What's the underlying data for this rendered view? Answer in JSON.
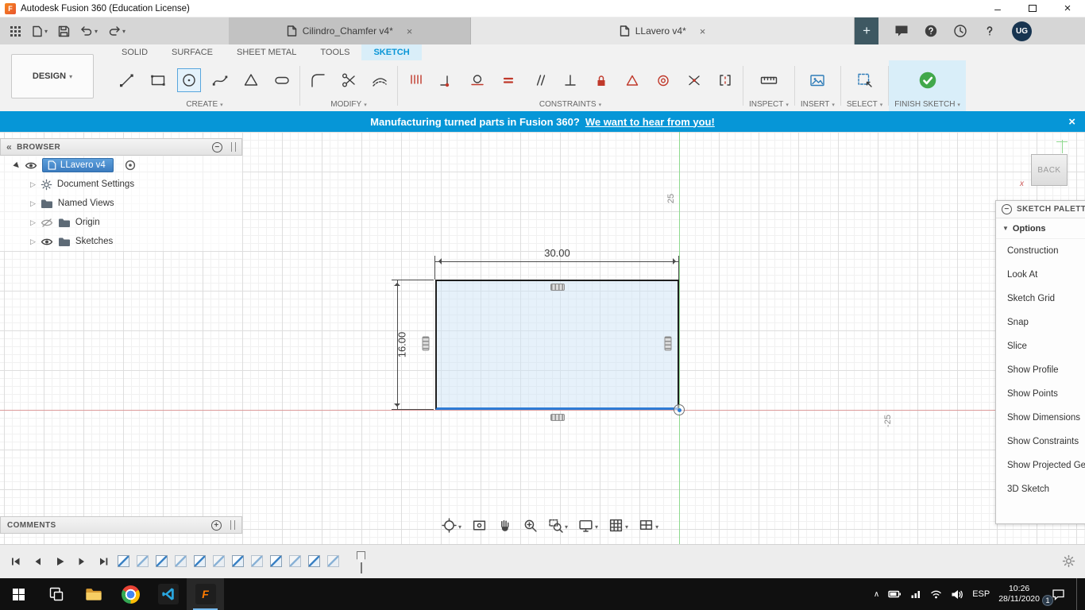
{
  "window": {
    "app_title": "Autodesk Fusion 360 (Education License)"
  },
  "doc_tabs": {
    "tab1": "Cilindro_Chamfer v4*",
    "tab2": "LLavero v4*",
    "avatar": "UG"
  },
  "ribbon": {
    "design": "DESIGN",
    "tabs": {
      "solid": "SOLID",
      "surface": "SURFACE",
      "sheet_metal": "SHEET METAL",
      "tools": "TOOLS",
      "sketch": "SKETCH"
    },
    "groups": {
      "create": "CREATE",
      "modify": "MODIFY",
      "constraints": "CONSTRAINTS",
      "inspect": "INSPECT",
      "insert": "INSERT",
      "select": "SELECT",
      "finish": "FINISH SKETCH"
    }
  },
  "banner": {
    "text": "Manufacturing turned parts in Fusion 360?",
    "link": "We want to hear from you!"
  },
  "browser": {
    "title": "BROWSER",
    "root_label": "LLavero v4",
    "items": {
      "document_settings": "Document Settings",
      "named_views": "Named Views",
      "origin": "Origin",
      "sketches": "Sketches"
    }
  },
  "sketch": {
    "width_dim": "30.00",
    "height_dim": "16.00",
    "y_axis_label": "25",
    "x_axis_label": "-25"
  },
  "viewcube": {
    "back": "BACK",
    "x_label": "x"
  },
  "palette": {
    "title": "SKETCH PALETTE",
    "options_header": "Options",
    "items": {
      "construction": "Construction",
      "look_at": "Look At",
      "sketch_grid": "Sketch Grid",
      "snap": "Snap",
      "slice": "Slice",
      "show_profile": "Show Profile",
      "show_points": "Show Points",
      "show_dimensions": "Show Dimensions",
      "show_constraints": "Show Constraints",
      "show_projected": "Show Projected Geometries",
      "sketch_3d": "3D Sketch"
    }
  },
  "comments": {
    "title": "COMMENTS"
  },
  "taskbar": {
    "lang": "ESP",
    "time": "10:26",
    "date": "28/11/2020",
    "badge": "1"
  },
  "colors": {
    "accent_blue": "#0696d7",
    "selected_line": "#2e7cd6",
    "axis_green": "#8fd98f",
    "axis_red": "#dc9a9a",
    "constraint_red": "#c0392b",
    "finish_green": "#41a84b"
  }
}
